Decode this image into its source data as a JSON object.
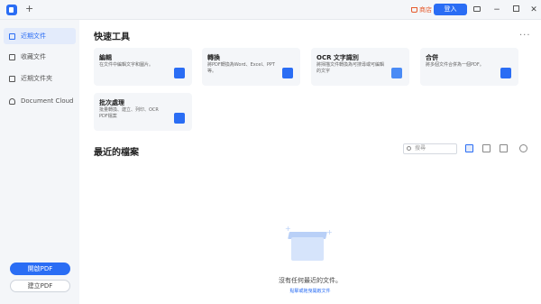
{
  "titlebar": {
    "new_tab": "+",
    "cart_label": "商店",
    "login_label": "登入",
    "minimize": "−",
    "close": "✕"
  },
  "sidebar": {
    "items": [
      {
        "label": "近期文件",
        "icon": "clock-icon",
        "active": true
      },
      {
        "label": "收藏文件",
        "icon": "star-icon",
        "active": false
      },
      {
        "label": "近期文件夾",
        "icon": "folder-icon",
        "active": false
      },
      {
        "label": "Document Cloud",
        "icon": "cloud-icon",
        "active": false
      }
    ],
    "open_pdf": "開啟PDF",
    "create_pdf": "建立PDF"
  },
  "quick_tools": {
    "title": "快速工具",
    "more": "···",
    "cards": [
      {
        "name": "編輯",
        "desc": "在文件中編輯文字和圖片。",
        "color": "#2a6df4"
      },
      {
        "name": "轉換",
        "desc": "將PDF轉換為Word、Excel、PPT等。",
        "color": "#2a6df4"
      },
      {
        "name": "OCR 文字識別",
        "desc": "將掃描文件轉換為可搜尋或可編輯的文字",
        "color": "#4a8bf5"
      },
      {
        "name": "合併",
        "desc": "將多個文件合併為一個PDF。",
        "color": "#2a6df4"
      },
      {
        "name": "批次處理",
        "desc": "批量轉換、建立、列印、OCR PDF檔案",
        "color": "#2a6df4"
      }
    ]
  },
  "recent": {
    "title": "最近的檔案",
    "search_placeholder": "搜尋",
    "empty_text": "沒有任何最近的文件。",
    "empty_link": "點擊或拖曳開啟文件"
  }
}
